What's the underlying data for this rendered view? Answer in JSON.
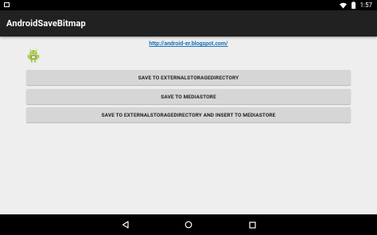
{
  "status_bar": {
    "time": "1:57",
    "icons": [
      "notification-icon",
      "wifi-icon",
      "battery-icon"
    ]
  },
  "app": {
    "title": "AndroidSaveBitmap"
  },
  "content": {
    "link_text": "http://android-er.blogspot.com/",
    "image_icon": "android-robot-icon",
    "buttons": [
      {
        "label": "SAVE TO EXTERNALSTORAGEDIRECTORY"
      },
      {
        "label": "SAVE TO MEDIASTORE"
      },
      {
        "label": "SAVE TO EXTERNALSTORAGEDIRECTORY AND INSERT TO MEDIASTORE"
      }
    ]
  },
  "nav_bar": {
    "icons": [
      "back-icon",
      "home-icon",
      "recents-icon"
    ]
  },
  "colors": {
    "status_bar": "#000000",
    "action_bar": "#212121",
    "background": "#eeeeee",
    "button": "#d6d6d6",
    "link": "#1a73b8",
    "android_green": "#a4c639"
  }
}
